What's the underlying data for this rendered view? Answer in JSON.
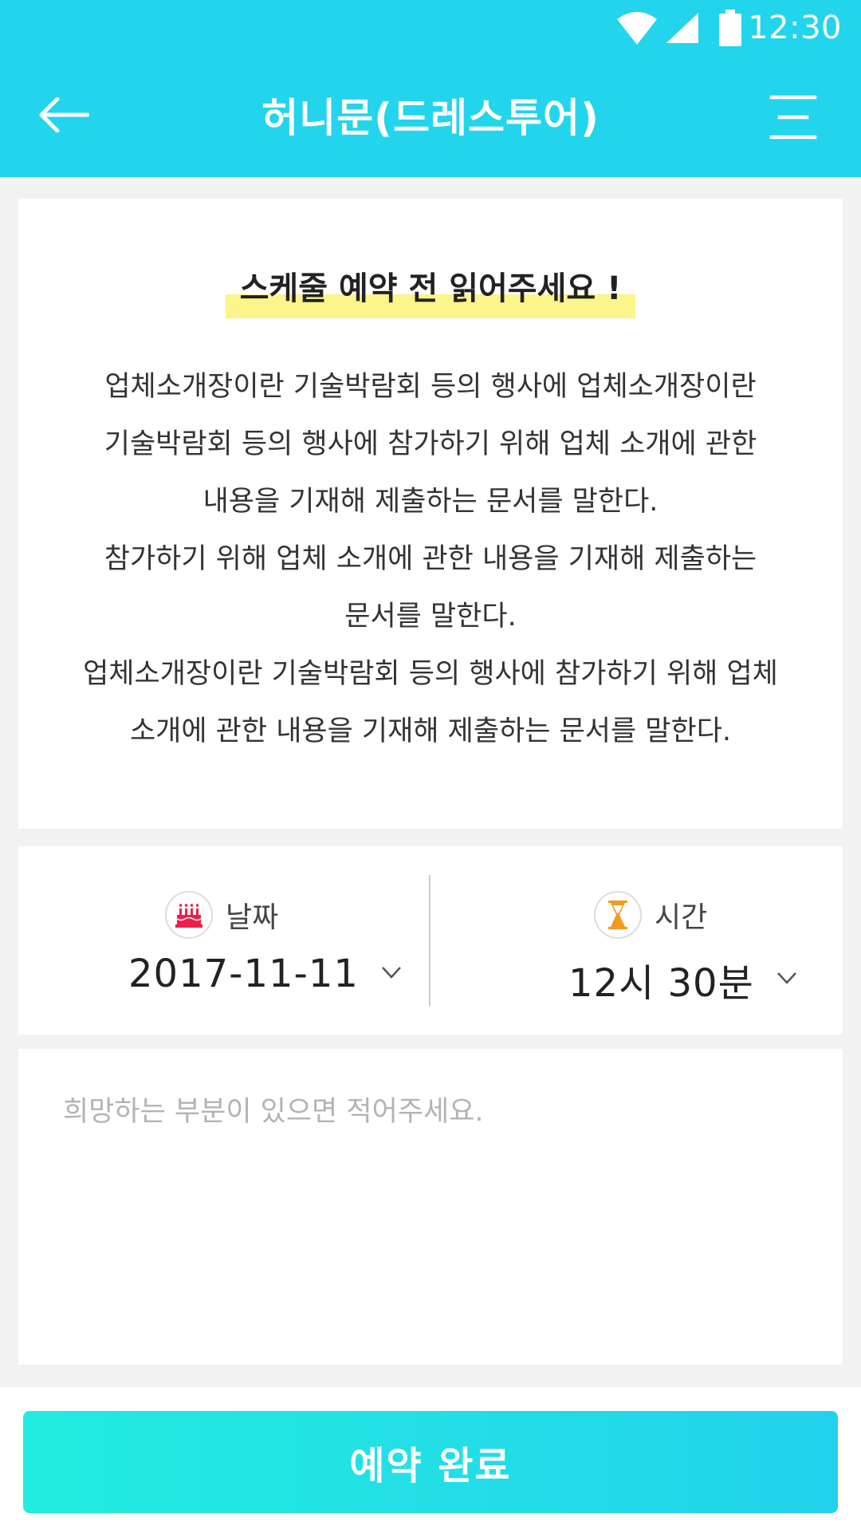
{
  "status_bar": {
    "time": "12:30"
  },
  "header": {
    "title": "허니문(드레스투어)",
    "back_icon": "arrow-left-icon",
    "menu_icon": "menu-icon",
    "background_color": "#22d5ec"
  },
  "notice": {
    "title": "스케줄 예약 전 읽어주세요 !",
    "highlight_color": "#fbf58a",
    "lines": [
      "업체소개장이란 기술박람회 등의 행사에 업체소개장이란",
      "기술박람회 등의 행사에 참가하기 위해 업체 소개에 관한",
      "내용을 기재해 제출하는 문서를 말한다.",
      "참가하기 위해 업체 소개에 관한 내용을 기재해 제출하는",
      "문서를 말한다.",
      "업체소개장이란 기술박람회 등의 행사에 참가하기 위해 업체",
      "소개에 관한 내용을 기재해 제출하는 문서를 말한다."
    ]
  },
  "schedule": {
    "date": {
      "label": "날짜",
      "value": "2017-11-11",
      "icon": "cake-icon"
    },
    "time": {
      "label": "시간",
      "value": "12시 30분",
      "icon": "hourglass-icon"
    }
  },
  "request": {
    "placeholder": "희망하는 부분이 있으면 적어주세요.",
    "value": ""
  },
  "submit": {
    "label": "예약 완료"
  }
}
